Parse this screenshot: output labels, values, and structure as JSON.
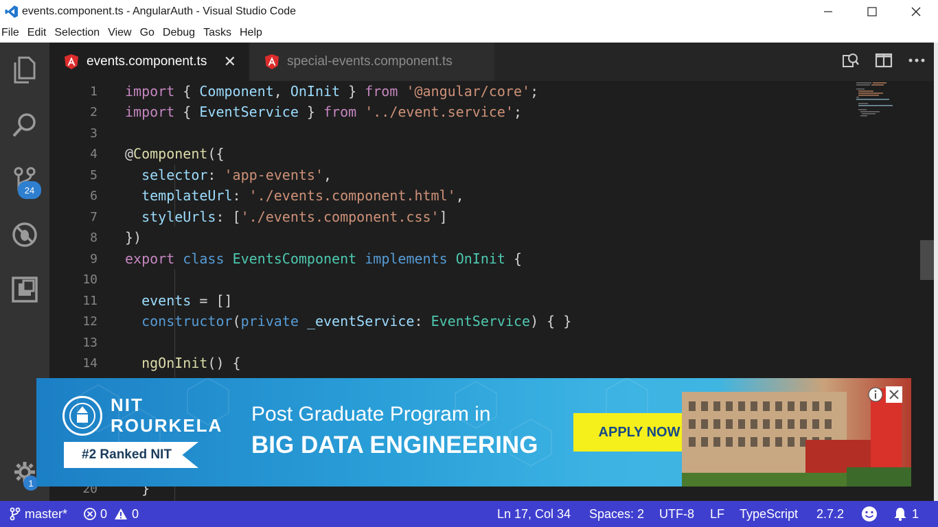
{
  "window": {
    "title": "events.component.ts - AngularAuth - Visual Studio Code",
    "app_icon": "vscode-icon",
    "controls": [
      "minimize-icon",
      "maximize-icon",
      "close-icon"
    ]
  },
  "menu": [
    "File",
    "Edit",
    "Selection",
    "View",
    "Go",
    "Debug",
    "Tasks",
    "Help"
  ],
  "activity_bar": {
    "items": [
      "explorer-icon",
      "search-icon",
      "source-control-icon",
      "debug-icon",
      "extensions-icon"
    ],
    "source_control_badge": "24",
    "settings_badge": "1"
  },
  "tabs": [
    {
      "label": "events.component.ts",
      "active": true,
      "icon": "angular-icon"
    },
    {
      "label": "special-events.component.ts",
      "active": false,
      "icon": "angular-icon"
    }
  ],
  "tab_close_glyph": "✕",
  "editor_actions": [
    "open-changes-icon",
    "split-editor-icon",
    "more-actions-icon"
  ],
  "code": {
    "line_numbers": [
      "1",
      "2",
      "3",
      "4",
      "5",
      "6",
      "7",
      "8",
      "9",
      "10",
      "11",
      "12",
      "13",
      "14",
      "20"
    ],
    "lines": [
      [
        [
          "kw",
          "import"
        ],
        [
          "pl",
          " { "
        ],
        [
          "id",
          "Component"
        ],
        [
          "pl",
          ", "
        ],
        [
          "id",
          "OnInit"
        ],
        [
          "pl",
          " } "
        ],
        [
          "kw",
          "from"
        ],
        [
          "pl",
          " "
        ],
        [
          "str",
          "'@angular/core'"
        ],
        [
          "pl",
          ";"
        ]
      ],
      [
        [
          "kw",
          "import"
        ],
        [
          "pl",
          " { "
        ],
        [
          "id",
          "EventService"
        ],
        [
          "pl",
          " } "
        ],
        [
          "kw",
          "from"
        ],
        [
          "pl",
          " "
        ],
        [
          "str",
          "'../event.service'"
        ],
        [
          "pl",
          ";"
        ]
      ],
      [],
      [
        [
          "pl",
          "@"
        ],
        [
          "fn",
          "Component"
        ],
        [
          "pl",
          "({"
        ]
      ],
      [
        [
          "pl",
          "  "
        ],
        [
          "id",
          "selector"
        ],
        [
          "pl",
          ": "
        ],
        [
          "str",
          "'app-events'"
        ],
        [
          "pl",
          ","
        ]
      ],
      [
        [
          "pl",
          "  "
        ],
        [
          "id",
          "templateUrl"
        ],
        [
          "pl",
          ": "
        ],
        [
          "str",
          "'./events.component.html'"
        ],
        [
          "pl",
          ","
        ]
      ],
      [
        [
          "pl",
          "  "
        ],
        [
          "id",
          "styleUrls"
        ],
        [
          "pl",
          ": ["
        ],
        [
          "str",
          "'./events.component.css'"
        ],
        [
          "pl",
          "]"
        ]
      ],
      [
        [
          "pl",
          "})"
        ]
      ],
      [
        [
          "kw",
          "export"
        ],
        [
          "pl",
          " "
        ],
        [
          "kw2",
          "class"
        ],
        [
          "pl",
          " "
        ],
        [
          "ty",
          "EventsComponent"
        ],
        [
          "pl",
          " "
        ],
        [
          "kw2",
          "implements"
        ],
        [
          "pl",
          " "
        ],
        [
          "ty",
          "OnInit"
        ],
        [
          "pl",
          " {"
        ]
      ],
      [],
      [
        [
          "pl",
          "  "
        ],
        [
          "id",
          "events"
        ],
        [
          "pl",
          " = []"
        ]
      ],
      [
        [
          "pl",
          "  "
        ],
        [
          "kw2",
          "constructor"
        ],
        [
          "pl",
          "("
        ],
        [
          "kw2",
          "private"
        ],
        [
          "pl",
          " "
        ],
        [
          "id",
          "_eventService"
        ],
        [
          "pl",
          ": "
        ],
        [
          "ty",
          "EventService"
        ],
        [
          "pl",
          ") { }"
        ]
      ],
      [],
      [
        [
          "pl",
          "  "
        ],
        [
          "fn",
          "ngOnInit"
        ],
        [
          "pl",
          "() {"
        ]
      ],
      [
        [
          "pl",
          "  }"
        ]
      ]
    ]
  },
  "ad": {
    "institute_line1": "NIT",
    "institute_line2": "ROURKELA",
    "ranked": "#2 Ranked NIT",
    "headline1": "Post Graduate Program in",
    "headline2": "BIG DATA ENGINEERING",
    "cta": "APPLY NOW",
    "info_icon": "info-icon",
    "close_icon": "close-icon"
  },
  "status_bar": {
    "branch": "master*",
    "errors": "0",
    "warnings": "0",
    "position": "Ln 17, Col 34",
    "spaces": "Spaces: 2",
    "encoding": "UTF-8",
    "eol": "LF",
    "language": "TypeScript",
    "version": "2.7.2",
    "notifications": "1"
  },
  "colors": {
    "status_bar": "#3f3fcf",
    "editor_bg": "#1e1e1e",
    "activity_bar": "#333333",
    "keyword": "#c586c0",
    "string": "#ce9178",
    "type": "#4ec9b0",
    "identifier": "#9cdcfe"
  }
}
